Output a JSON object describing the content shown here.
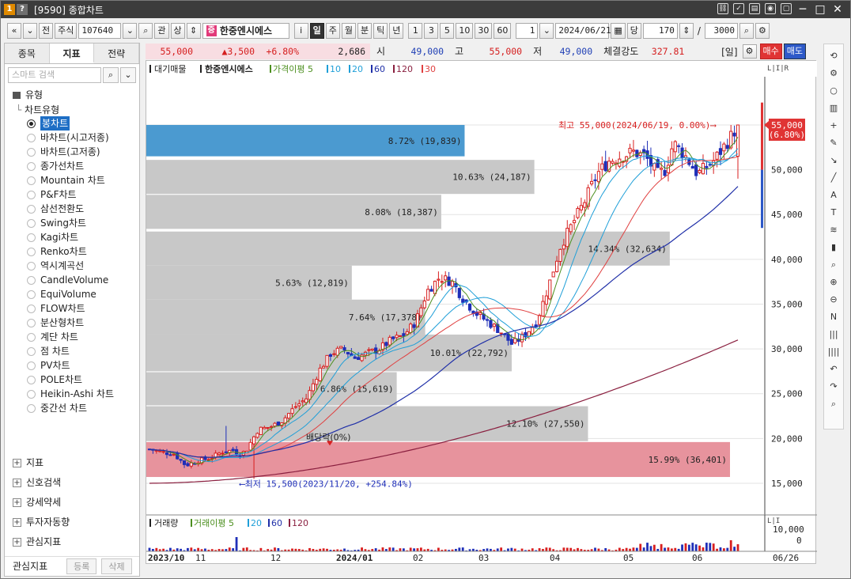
{
  "window": {
    "badge1": "1",
    "badge2": "?",
    "title": "[9590] 종합차트"
  },
  "toolbar": {
    "prev": "«",
    "down": "»",
    "jeon": "전",
    "market": "주식",
    "code": "107640",
    "gwan": "관",
    "sang": "상",
    "stock_tag": "증",
    "stock_name": "한중엔시에스",
    "info": "i",
    "periods": [
      "일",
      "주",
      "월",
      "분",
      "틱",
      "년"
    ],
    "active_period": "일",
    "minutes": [
      "1",
      "3",
      "5",
      "10",
      "30",
      "60"
    ],
    "count": "1",
    "date": "2024/06/21",
    "dang": "당",
    "bars": "170",
    "slash": "/",
    "total": "3000"
  },
  "left_panel": {
    "tabs": [
      "종목",
      "지표",
      "전략"
    ],
    "active_tab": "지표",
    "search_placeholder": "스마트 검색",
    "section_title": "유형",
    "tree_root": "차트유형",
    "chart_types": [
      "봉차트",
      "바차트(시고저종)",
      "바차트(고저종)",
      "종가선차트",
      "Mountain 차트",
      "P&F차트",
      "삼선전환도",
      "Swing차트",
      "Kagi차트",
      "Renko차트",
      "역시계곡선",
      "CandleVolume",
      "EquiVolume",
      "FLOW차트",
      "분산형차트",
      "계단 차트",
      "점 차트",
      "PV차트",
      "POLE차트",
      "Heikin-Ashi 차트",
      "중간선 차트"
    ],
    "selected_type": "봉차트",
    "bottom_sections": [
      "지표",
      "신호검색",
      "강세약세",
      "투자자동향",
      "관심지표"
    ],
    "footer_label": "관심지표",
    "footer_btn1": "등록",
    "footer_btn2": "삭제"
  },
  "infobar": {
    "price": "55,000",
    "change": "▲3,500",
    "change_pct": "+6.80%",
    "volume": "2,686",
    "open_label": "시",
    "open": "49,000",
    "high_label": "고",
    "high": "55,000",
    "low_label": "저",
    "low": "49,000",
    "strength_label": "체결강도",
    "strength": "327.81",
    "period_tag": "[일]",
    "buy": "매수",
    "sell": "매도"
  },
  "chart_data": {
    "type": "candlestick",
    "legend": {
      "prefix": "대기매물",
      "name": "한중엔시에스",
      "ma_label": "가격이평",
      "ma_periods": [
        "5",
        "10",
        "20",
        "60",
        "120",
        "30"
      ]
    },
    "colors": {
      "up": "#d81f1f",
      "down": "#1f2fb8",
      "ma5": "#4c8f1f",
      "ma10": "#1f9fd8",
      "ma20": "#1f9fd8",
      "ma60": "#1f2fa8",
      "ma120": "#8a1f3f",
      "ma30": "#e04040"
    },
    "y_ticks": [
      "55,000",
      "50,000",
      "45,000",
      "40,000",
      "35,000",
      "30,000",
      "25,000",
      "20,000",
      "15,000"
    ],
    "y_values": [
      55000,
      50000,
      45000,
      40000,
      35000,
      30000,
      25000,
      20000,
      15000
    ],
    "ylim": [
      12700,
      58000
    ],
    "current_price": "55,000",
    "current_pct": "(6.80%)",
    "max_label": "최고 55,000(2024/06/19, 0.00%)",
    "min_label": "최저 15,500(2023/11/20, +254.84%)",
    "dividend_label": "배당락(0%)",
    "volume_profile": [
      {
        "low": 51500,
        "high": 55000,
        "label": "8.72% (19,839)",
        "pct": 8.72,
        "highlight": "current"
      },
      {
        "low": 47300,
        "high": 51100,
        "label": "10.63% (24,187)",
        "pct": 10.63
      },
      {
        "low": 43400,
        "high": 47200,
        "label": "8.08% (18,387)",
        "pct": 8.08
      },
      {
        "low": 39300,
        "high": 43100,
        "label": "14.34% (32,634)",
        "pct": 14.34
      },
      {
        "low": 35500,
        "high": 39300,
        "label": "5.63% (12,819)",
        "pct": 5.63
      },
      {
        "low": 31600,
        "high": 35500,
        "label": "7.64% (17,378)",
        "pct": 7.64
      },
      {
        "low": 27500,
        "high": 31600,
        "label": "10.01% (22,792)",
        "pct": 10.01
      },
      {
        "low": 23700,
        "high": 27400,
        "label": "6.86% (15,619)",
        "pct": 6.86
      },
      {
        "low": 19700,
        "high": 23600,
        "label": "12.10% (27,550)",
        "pct": 12.1
      },
      {
        "low": 15700,
        "high": 19600,
        "label": "15.99% (36,401)",
        "pct": 15.99,
        "highlight": "max"
      }
    ],
    "x_labels": [
      "2023/10",
      "11",
      "12",
      "2024/01",
      "02",
      "03",
      "04",
      "05",
      "06"
    ],
    "x_end_label": "06/26",
    "volume_legend": {
      "prefix": "거래량",
      "ma_label": "거래이평",
      "ma_periods": [
        "5",
        "20",
        "60",
        "120"
      ]
    },
    "volume_ticks": [
      "10,000",
      "0"
    ]
  },
  "right_toolbar": [
    "refresh-icon",
    "settings-icon",
    "circle-icon",
    "chart-icon",
    "crosshair-icon",
    "pen-icon",
    "arrow-icon",
    "line-icon",
    "auto-icon",
    "text-icon",
    "fib-icon",
    "candle-icon",
    "zoom-icon",
    "zoom-in-icon",
    "zoom-out-icon",
    "n-icon",
    "bars-icon",
    "bars2-icon",
    "undo-icon",
    "redo-icon",
    "search-icon"
  ]
}
